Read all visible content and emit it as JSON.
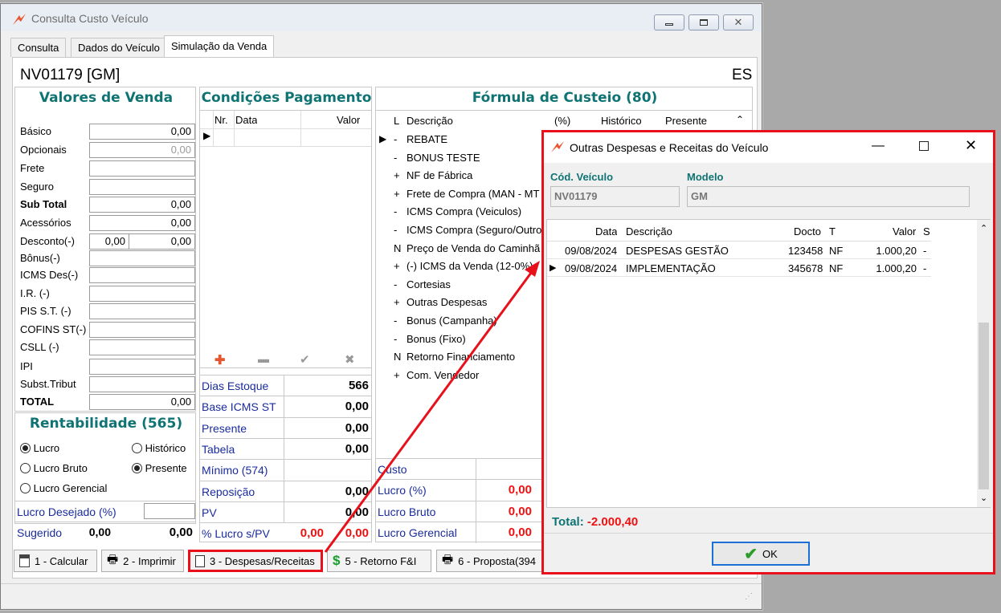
{
  "window": {
    "title": "Consulta Custo Veículo"
  },
  "tabs": [
    "Consulta",
    "Dados do Veículo",
    "Simulação da Venda"
  ],
  "vehicle": {
    "code_title": "NV01179 [GM]",
    "state": "ES"
  },
  "valores_venda": {
    "title": "Valores de Venda",
    "rows": [
      {
        "label": "Básico",
        "value": "0,00"
      },
      {
        "label": "Opcionais",
        "value": "0,00"
      },
      {
        "label": "Frete",
        "value": ""
      },
      {
        "label": "Seguro",
        "value": ""
      },
      {
        "label": "Sub Total",
        "value": "0,00"
      },
      {
        "label": "Acessórios",
        "value": "0,00"
      },
      {
        "label": "Desconto(-)",
        "value": "0,00",
        "value2": "0,00"
      },
      {
        "label": "Bônus(-)",
        "value": ""
      },
      {
        "label": "ICMS Des(-)",
        "value": ""
      },
      {
        "label": "I.R. (-)",
        "value": ""
      },
      {
        "label": "PIS S.T. (-)",
        "value": ""
      },
      {
        "label": "COFINS ST(-)",
        "value": ""
      },
      {
        "label": "CSLL (-)",
        "value": ""
      },
      {
        "label": "IPI",
        "value": ""
      },
      {
        "label": "Subst.Tribut",
        "value": ""
      },
      {
        "label": "TOTAL",
        "value": "0,00"
      }
    ]
  },
  "rentabilidade": {
    "title": "Rentabilidade (565)",
    "lucro": "Lucro",
    "lucro_bruto": "Lucro Bruto",
    "lucro_gerencial": "Lucro Gerencial",
    "historico": "Histórico",
    "presente": "Presente",
    "lucro_desejado_label": "Lucro Desejado (%)",
    "sugerido_label": "Sugerido",
    "sugerido_v1": "0,00",
    "sugerido_v2": "0,00"
  },
  "condicoes": {
    "title": "Condições Pagamento",
    "col_nr": "Nr.",
    "col_data": "Data",
    "col_valor": "Valor",
    "rows": [
      {
        "label": "Dias Estoque",
        "value": "566"
      },
      {
        "label": "Base ICMS ST",
        "value": "0,00"
      },
      {
        "label": "Presente",
        "value": "0,00"
      },
      {
        "label": "Tabela",
        "value": "0,00"
      },
      {
        "label": "Mínimo (574)",
        "value": ""
      },
      {
        "label": "Reposição",
        "value": "0,00"
      },
      {
        "label": "PV",
        "value": "0,00"
      }
    ],
    "lucro_pv_label": "% Lucro s/PV",
    "lucro_pv_v1": "0,00",
    "lucro_pv_v2": "0,00"
  },
  "formula": {
    "title": "Fórmula de Custeio (80)",
    "col_l": "L",
    "col_desc": "Descrição",
    "col_pct": "(%)",
    "col_hist": "Histórico",
    "col_pres": "Presente",
    "rows": [
      {
        "l": "-",
        "desc": "REBATE"
      },
      {
        "l": "-",
        "desc": "BONUS TESTE"
      },
      {
        "l": "+",
        "desc": "NF de Fábrica"
      },
      {
        "l": "+",
        "desc": "Frete de Compra (MAN - MT"
      },
      {
        "l": "-",
        "desc": "ICMS Compra (Veiculos)"
      },
      {
        "l": "-",
        "desc": "ICMS Compra (Seguro/Outro"
      },
      {
        "l": "N",
        "desc": "Preço de Venda do Caminhã"
      },
      {
        "l": "+",
        "desc": "(-) ICMS da Venda (12-0%)"
      },
      {
        "l": "-",
        "desc": "Cortesias"
      },
      {
        "l": "+",
        "desc": "Outras Despesas"
      },
      {
        "l": "-",
        "desc": "Bonus (Campanha)"
      },
      {
        "l": "-",
        "desc": "Bonus (Fixo)"
      },
      {
        "l": "N",
        "desc": "Retorno Financiamento"
      },
      {
        "l": "+",
        "desc": "Com. Vendedor"
      }
    ],
    "summary": [
      {
        "label": "Custo",
        "value": ""
      },
      {
        "label": "Lucro (%)",
        "value": "0,00"
      },
      {
        "label": "Lucro Bruto",
        "value": "0,00"
      },
      {
        "label": "Lucro Gerencial",
        "value": "0,00"
      }
    ]
  },
  "buttons": {
    "calcular": "1 - Calcular",
    "imprimir": "2 - Imprimir",
    "despesas": "3 - Despesas/Receitas",
    "retorno": "5 - Retorno F&I",
    "proposta": "6 - Proposta(394"
  },
  "dialog": {
    "title": "Outras Despesas e Receitas do Veículo",
    "cod_label": "Cód. Veículo",
    "cod_value": "NV01179",
    "modelo_label": "Modelo",
    "modelo_value": "GM",
    "cols": {
      "data": "Data",
      "desc": "Descrição",
      "docto": "Docto",
      "t": "T",
      "valor": "Valor",
      "s": "S"
    },
    "rows": [
      {
        "data": "09/08/2024",
        "desc": "DESPESAS GESTÃO",
        "docto": "123458",
        "t": "NF",
        "valor": "1.000,20",
        "s": "-"
      },
      {
        "data": "09/08/2024",
        "desc": "IMPLEMENTAÇÃO",
        "docto": "345678",
        "t": "NF",
        "valor": "1.000,20",
        "s": "-"
      }
    ],
    "total_label": "Total:",
    "total_value": "-2.000,40",
    "ok_label": "OK"
  },
  "colors": {
    "teal": "#0f7373",
    "blue": "#1a2c9c",
    "red": "#ee1111",
    "highlight": "#e8101a"
  }
}
